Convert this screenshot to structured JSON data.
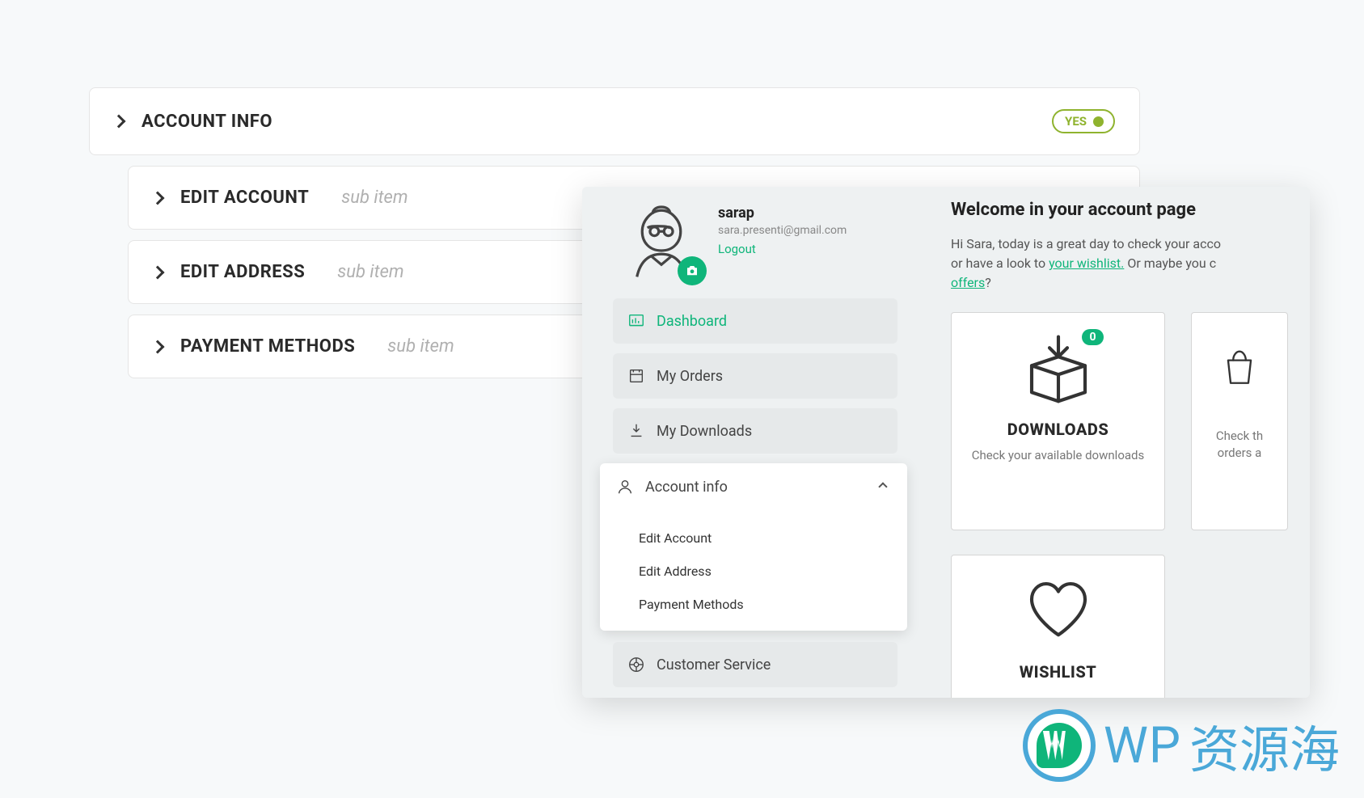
{
  "config": {
    "main": {
      "title": "ACCOUNT INFO",
      "badge": "YES"
    },
    "subs": [
      {
        "title": "EDIT ACCOUNT",
        "suffix": "sub item"
      },
      {
        "title": "EDIT ADDRESS",
        "suffix": "sub item"
      },
      {
        "title": "PAYMENT METHODS",
        "suffix": "sub item"
      }
    ]
  },
  "preview": {
    "profile": {
      "name": "sarap",
      "email": "sara.presenti@gmail.com",
      "logout": "Logout"
    },
    "menu": {
      "dashboard": "Dashboard",
      "orders": "My Orders",
      "downloads": "My Downloads",
      "account_info": "Account info",
      "submenu": {
        "edit_account": "Edit Account",
        "edit_address": "Edit Address",
        "payment_methods": "Payment Methods"
      },
      "customer_service": "Customer Service"
    },
    "welcome": {
      "title": "Welcome in your account page",
      "line1_pre": "Hi Sara, today is a great day to check your acco",
      "line2_pre": "or have a look to ",
      "wishlist_link": "your wishlist.",
      "line2_post": " Or maybe you c",
      "offers_link": "offers",
      "qmark": "?"
    },
    "cards": {
      "downloads": {
        "title": "DOWNLOADS",
        "sub": "Check your available downloads",
        "badge": "0"
      },
      "orders": {
        "sub1": "Check th",
        "sub2": "orders a"
      },
      "wishlist": {
        "title": "WISHLIST"
      }
    }
  },
  "watermark": {
    "text": "WP",
    "cn": "资源海"
  }
}
